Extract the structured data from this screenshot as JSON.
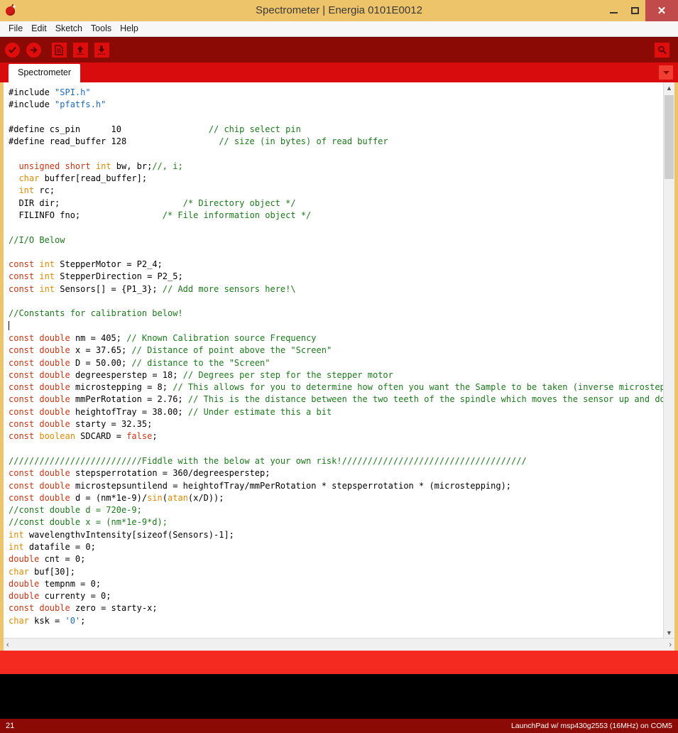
{
  "window": {
    "title": "Spectrometer | Energia 0101E0012",
    "app_icon": "energia-logo-icon",
    "minimize_label": "–",
    "maximize_label": "□",
    "close_label": "✕"
  },
  "menubar": {
    "items": [
      {
        "label": "File"
      },
      {
        "label": "Edit"
      },
      {
        "label": "Sketch"
      },
      {
        "label": "Tools"
      },
      {
        "label": "Help"
      }
    ]
  },
  "toolbar": {
    "buttons": [
      {
        "name": "verify-button",
        "icon": "checkmark-icon",
        "tooltip": "Verify"
      },
      {
        "name": "upload-button",
        "icon": "arrow-right-icon",
        "tooltip": "Upload"
      },
      {
        "name": "new-button",
        "icon": "new-document-icon",
        "tooltip": "New"
      },
      {
        "name": "open-button",
        "icon": "arrow-up-icon",
        "tooltip": "Open"
      },
      {
        "name": "save-button",
        "icon": "arrow-down-icon",
        "tooltip": "Save"
      }
    ],
    "serial_monitor": {
      "name": "serial-monitor-button",
      "icon": "magnifier-icon",
      "tooltip": "Serial Monitor"
    }
  },
  "tabs": {
    "items": [
      {
        "label": "Spectrometer",
        "active": true
      }
    ],
    "menu_icon": "chevron-down-icon"
  },
  "scrollbars": {
    "up_arrow": "▲",
    "down_arrow": "▼",
    "left_arrow": "‹",
    "right_arrow": "›"
  },
  "statusbar": {
    "line_number": "21",
    "board_info": "LaunchPad w/ msp430g2553 (16MHz) on COM5"
  },
  "editor": {
    "language": "cpp",
    "lines": [
      [
        {
          "t": "#include ",
          "c": ""
        },
        {
          "t": "\"SPI.h\"",
          "c": "st"
        }
      ],
      [
        {
          "t": "#include ",
          "c": ""
        },
        {
          "t": "\"pfatfs.h\"",
          "c": "st"
        }
      ],
      [],
      [
        {
          "t": "#define cs_pin      10                 ",
          "c": ""
        },
        {
          "t": "// chip select pin",
          "c": "cm"
        }
      ],
      [
        {
          "t": "#define read_buffer 128                 ",
          "c": ""
        },
        {
          "t": " // size (in bytes) of read buffer",
          "c": "cm"
        }
      ],
      [],
      [
        {
          "t": "  ",
          "c": ""
        },
        {
          "t": "unsigned",
          "c": "kw"
        },
        {
          "t": " ",
          "c": ""
        },
        {
          "t": "short",
          "c": "kw"
        },
        {
          "t": " ",
          "c": ""
        },
        {
          "t": "int",
          "c": "kw2"
        },
        {
          "t": " bw, br;",
          "c": ""
        },
        {
          "t": "//, i;",
          "c": "cm"
        }
      ],
      [
        {
          "t": "  ",
          "c": ""
        },
        {
          "t": "char",
          "c": "kw2"
        },
        {
          "t": " buffer[read_buffer];",
          "c": ""
        }
      ],
      [
        {
          "t": "  ",
          "c": ""
        },
        {
          "t": "int",
          "c": "kw2"
        },
        {
          "t": " rc;",
          "c": ""
        }
      ],
      [
        {
          "t": "  DIR dir;                        ",
          "c": ""
        },
        {
          "t": "/* Directory object */",
          "c": "cm"
        }
      ],
      [
        {
          "t": "  FILINFO fno;                ",
          "c": ""
        },
        {
          "t": "/* File information object */",
          "c": "cm"
        }
      ],
      [],
      [
        {
          "t": "//I/O Below",
          "c": "cm"
        }
      ],
      [],
      [
        {
          "t": "const",
          "c": "kw"
        },
        {
          "t": " ",
          "c": ""
        },
        {
          "t": "int",
          "c": "kw2"
        },
        {
          "t": " StepperMotor = P2_4;",
          "c": ""
        }
      ],
      [
        {
          "t": "const",
          "c": "kw"
        },
        {
          "t": " ",
          "c": ""
        },
        {
          "t": "int",
          "c": "kw2"
        },
        {
          "t": " StepperDirection = P2_5;",
          "c": ""
        }
      ],
      [
        {
          "t": "const",
          "c": "kw"
        },
        {
          "t": " ",
          "c": ""
        },
        {
          "t": "int",
          "c": "kw2"
        },
        {
          "t": " Sensors[] = {P1_3}; ",
          "c": ""
        },
        {
          "t": "// Add more sensors here!\\",
          "c": "cm"
        }
      ],
      [],
      [
        {
          "t": "//Constants for calibration below!",
          "c": "cm"
        }
      ],
      [
        {
          "t": "|CARET|",
          "c": ""
        }
      ],
      [
        {
          "t": "const",
          "c": "kw"
        },
        {
          "t": " ",
          "c": ""
        },
        {
          "t": "double",
          "c": "kw"
        },
        {
          "t": " nm = 405; ",
          "c": ""
        },
        {
          "t": "// Known Calibration source Frequency",
          "c": "cm"
        }
      ],
      [
        {
          "t": "const",
          "c": "kw"
        },
        {
          "t": " ",
          "c": ""
        },
        {
          "t": "double",
          "c": "kw"
        },
        {
          "t": " x = 37.65; ",
          "c": ""
        },
        {
          "t": "// Distance of point above the \"Screen\"",
          "c": "cm"
        }
      ],
      [
        {
          "t": "const",
          "c": "kw"
        },
        {
          "t": " ",
          "c": ""
        },
        {
          "t": "double",
          "c": "kw"
        },
        {
          "t": " D = 50.00; ",
          "c": ""
        },
        {
          "t": "// distance to the \"Screen\"",
          "c": "cm"
        }
      ],
      [
        {
          "t": "const",
          "c": "kw"
        },
        {
          "t": " ",
          "c": ""
        },
        {
          "t": "double",
          "c": "kw"
        },
        {
          "t": " degreesperstep = 18; ",
          "c": ""
        },
        {
          "t": "// Degrees per step for the stepper motor",
          "c": "cm"
        }
      ],
      [
        {
          "t": "const",
          "c": "kw"
        },
        {
          "t": " ",
          "c": ""
        },
        {
          "t": "double",
          "c": "kw"
        },
        {
          "t": " microstepping = 8; ",
          "c": ""
        },
        {
          "t": "// This allows for you to determine how often you want the Sample to be taken (inverse microstep)",
          "c": "cm"
        }
      ],
      [
        {
          "t": "const",
          "c": "kw"
        },
        {
          "t": " ",
          "c": ""
        },
        {
          "t": "double",
          "c": "kw"
        },
        {
          "t": " mmPerRotation = 2.76; ",
          "c": ""
        },
        {
          "t": "// This is the distance between the two teeth of the spindle which moves the sensor up and down",
          "c": "cm"
        }
      ],
      [
        {
          "t": "const",
          "c": "kw"
        },
        {
          "t": " ",
          "c": ""
        },
        {
          "t": "double",
          "c": "kw"
        },
        {
          "t": " heightofTray = 38.00; ",
          "c": ""
        },
        {
          "t": "// Under estimate this a bit",
          "c": "cm"
        }
      ],
      [
        {
          "t": "const",
          "c": "kw"
        },
        {
          "t": " ",
          "c": ""
        },
        {
          "t": "double",
          "c": "kw"
        },
        {
          "t": " starty = 32.35;",
          "c": ""
        }
      ],
      [
        {
          "t": "const",
          "c": "kw"
        },
        {
          "t": " ",
          "c": ""
        },
        {
          "t": "boolean",
          "c": "kw2"
        },
        {
          "t": " SDCARD = ",
          "c": ""
        },
        {
          "t": "false",
          "c": "kw"
        },
        {
          "t": ";",
          "c": ""
        }
      ],
      [],
      [
        {
          "t": "//////////////////////////Fiddle with the below at your own risk!////////////////////////////////////",
          "c": "cm"
        }
      ],
      [
        {
          "t": "const",
          "c": "kw"
        },
        {
          "t": " ",
          "c": ""
        },
        {
          "t": "double",
          "c": "kw"
        },
        {
          "t": " stepsperrotation = 360/degreesperstep;",
          "c": ""
        }
      ],
      [
        {
          "t": "const",
          "c": "kw"
        },
        {
          "t": " ",
          "c": ""
        },
        {
          "t": "double",
          "c": "kw"
        },
        {
          "t": " microstepsuntilend = heightofTray/mmPerRotation * stepsperrotation * (microstepping);",
          "c": ""
        }
      ],
      [
        {
          "t": "const",
          "c": "kw"
        },
        {
          "t": " ",
          "c": ""
        },
        {
          "t": "double",
          "c": "kw"
        },
        {
          "t": " d = (nm*1e-9)/",
          "c": ""
        },
        {
          "t": "sin",
          "c": "fn"
        },
        {
          "t": "(",
          "c": ""
        },
        {
          "t": "atan",
          "c": "fn"
        },
        {
          "t": "(x/D));",
          "c": ""
        }
      ],
      [
        {
          "t": "//const double d = 720e-9;",
          "c": "cm"
        }
      ],
      [
        {
          "t": "//const double x = (nm*1e-9*d);",
          "c": "cm"
        }
      ],
      [
        {
          "t": "int",
          "c": "kw2"
        },
        {
          "t": " wavelengthvIntensity[sizeof(Sensors)-1];",
          "c": ""
        }
      ],
      [
        {
          "t": "int",
          "c": "kw2"
        },
        {
          "t": " datafile = 0;",
          "c": ""
        }
      ],
      [
        {
          "t": "double",
          "c": "kw"
        },
        {
          "t": " cnt = 0;",
          "c": ""
        }
      ],
      [
        {
          "t": "char",
          "c": "kw2"
        },
        {
          "t": " buf[30];",
          "c": ""
        }
      ],
      [
        {
          "t": "double",
          "c": "kw"
        },
        {
          "t": " tempnm = 0;",
          "c": ""
        }
      ],
      [
        {
          "t": "double",
          "c": "kw"
        },
        {
          "t": " currenty = 0;",
          "c": ""
        }
      ],
      [
        {
          "t": "const",
          "c": "kw"
        },
        {
          "t": " ",
          "c": ""
        },
        {
          "t": "double",
          "c": "kw"
        },
        {
          "t": " zero = starty-x;",
          "c": ""
        }
      ],
      [
        {
          "t": "char",
          "c": "kw2"
        },
        {
          "t": " ksk = ",
          "c": ""
        },
        {
          "t": "'0'",
          "c": "st"
        },
        {
          "t": ";",
          "c": ""
        }
      ]
    ]
  },
  "colors": {
    "window_frame": "#eec46b",
    "toolbar_bg": "#8c0a06",
    "tabbar_bg": "#d80c0c",
    "message_bar": "#f42a21",
    "console_bg": "#000000",
    "keyword": "#cc3311",
    "type": "#e08a00",
    "comment": "#1a7a1a",
    "string": "#1a6bbf",
    "close_button": "#c14a4a"
  }
}
